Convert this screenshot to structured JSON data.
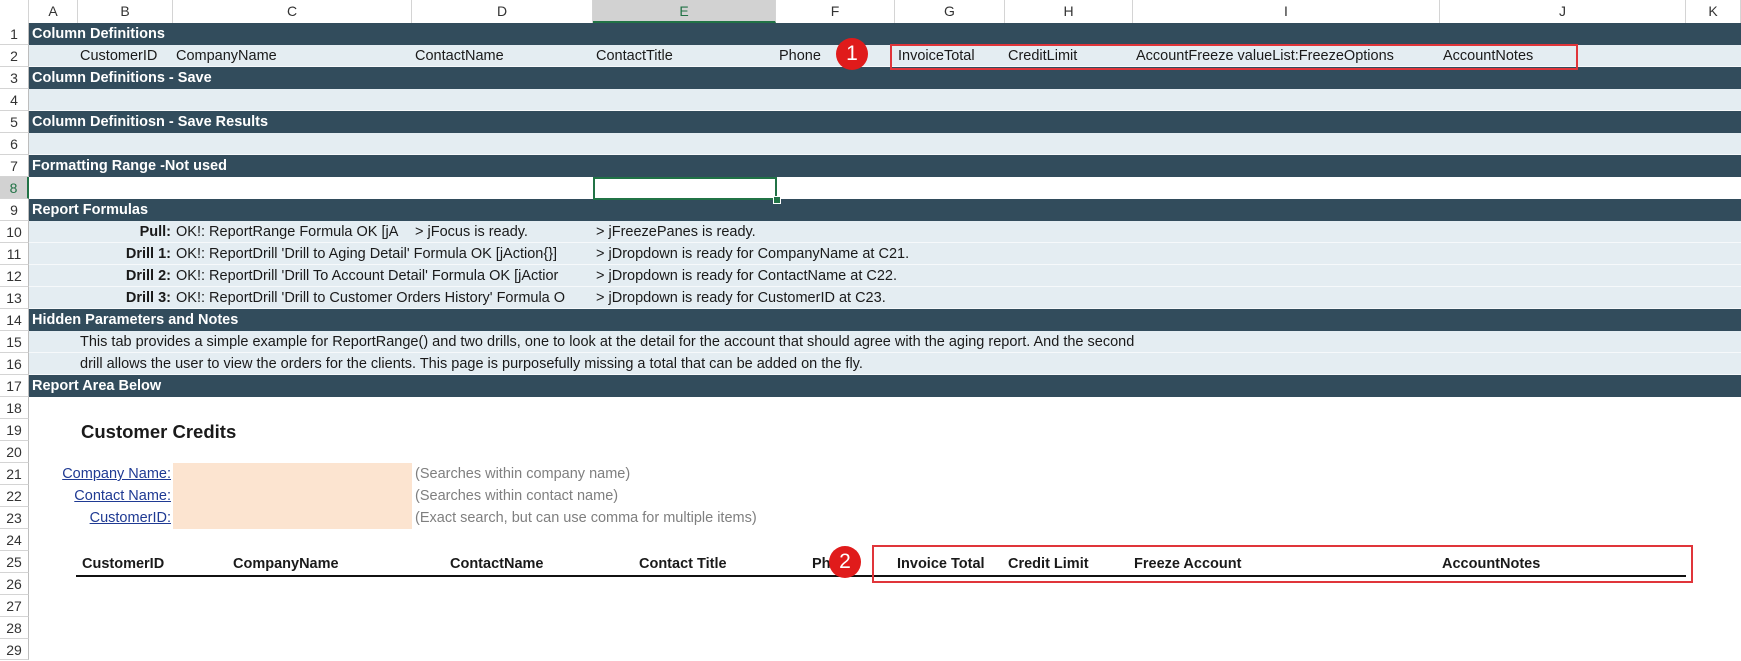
{
  "sheet": {
    "columns": [
      "A",
      "B",
      "C",
      "D",
      "E",
      "F",
      "G",
      "H",
      "I",
      "J",
      "K"
    ],
    "rows": [
      "1",
      "2",
      "3",
      "4",
      "5",
      "6",
      "7",
      "8",
      "9",
      "10",
      "11",
      "12",
      "13",
      "14",
      "15",
      "16",
      "17",
      "18",
      "19",
      "20",
      "21",
      "22",
      "23",
      "24",
      "25",
      "26",
      "27",
      "28",
      "29"
    ],
    "selected_column": "E",
    "selected_row": "8"
  },
  "sections": {
    "column_definitions": "Column Definitions",
    "column_definitions_save": "Column Definitions - Save",
    "column_definitions_save_results": "Column Definitiosn - Save Results",
    "formatting_range": "Formatting Range -Not used",
    "report_formulas": "Report Formulas",
    "hidden_params": "Hidden Parameters and Notes",
    "report_area": "Report Area Below"
  },
  "column_defs": {
    "customer_id": "CustomerID",
    "company_name": "CompanyName",
    "contact_name": "ContactName",
    "contact_title": "ContactTitle",
    "phone": "Phone",
    "invoice_total": "InvoiceTotal",
    "credit_limit": "CreditLimit",
    "account_freeze": "AccountFreeze valueList:FreezeOptions",
    "account_notes": "AccountNotes"
  },
  "formulas": [
    {
      "label": "Pull:",
      "status": "OK!: ReportRange Formula OK [jA",
      "result": "> jFocus is ready.",
      "result2": "> jFreezePanes is ready."
    },
    {
      "label": "Drill 1:",
      "status": "OK!: ReportDrill 'Drill to Aging Detail' Formula OK [jAction{}]",
      "result": "> jDropdown is ready for CompanyName at C21."
    },
    {
      "label": "Drill 2:",
      "status": "OK!: ReportDrill 'Drill To Account Detail' Formula OK [jActior",
      "result": "> jDropdown is ready for ContactName at C22."
    },
    {
      "label": "Drill 3:",
      "status": "OK!: ReportDrill 'Drill to Customer Orders History' Formula O",
      "result": "> jDropdown is ready for CustomerID at C23."
    }
  ],
  "notes": {
    "line1": "This tab provides a simple example for ReportRange() and two drills, one to look at the detail for the account that should agree with the aging report. And the second",
    "line2": "drill allows the user to view the orders for the clients.   This page is purposefully missing a total that can be added on the fly."
  },
  "report": {
    "title": "Customer Credits",
    "filters": [
      {
        "label": "Company Name:",
        "hint": "(Searches within company name)"
      },
      {
        "label": "Contact Name:",
        "hint": "(Searches within contact name)"
      },
      {
        "label": "CustomerID:",
        "hint": "(Exact search, but can use comma for multiple items)"
      }
    ],
    "headers": {
      "customer_id": "CustomerID",
      "company_name": "CompanyName",
      "contact_name": "ContactName",
      "contact_title": "Contact Title",
      "phone": "Ph",
      "invoice_total": "Invoice Total",
      "credit_limit": "Credit Limit",
      "freeze_account": "Freeze Account",
      "account_notes": "AccountNotes"
    }
  },
  "callouts": {
    "one": "1",
    "two": "2"
  },
  "colors": {
    "band_dark": "#324c5c",
    "band_light": "#e4edf2",
    "input_fill": "#fce4d0",
    "callout": "#e0353a",
    "selection": "#217346"
  }
}
